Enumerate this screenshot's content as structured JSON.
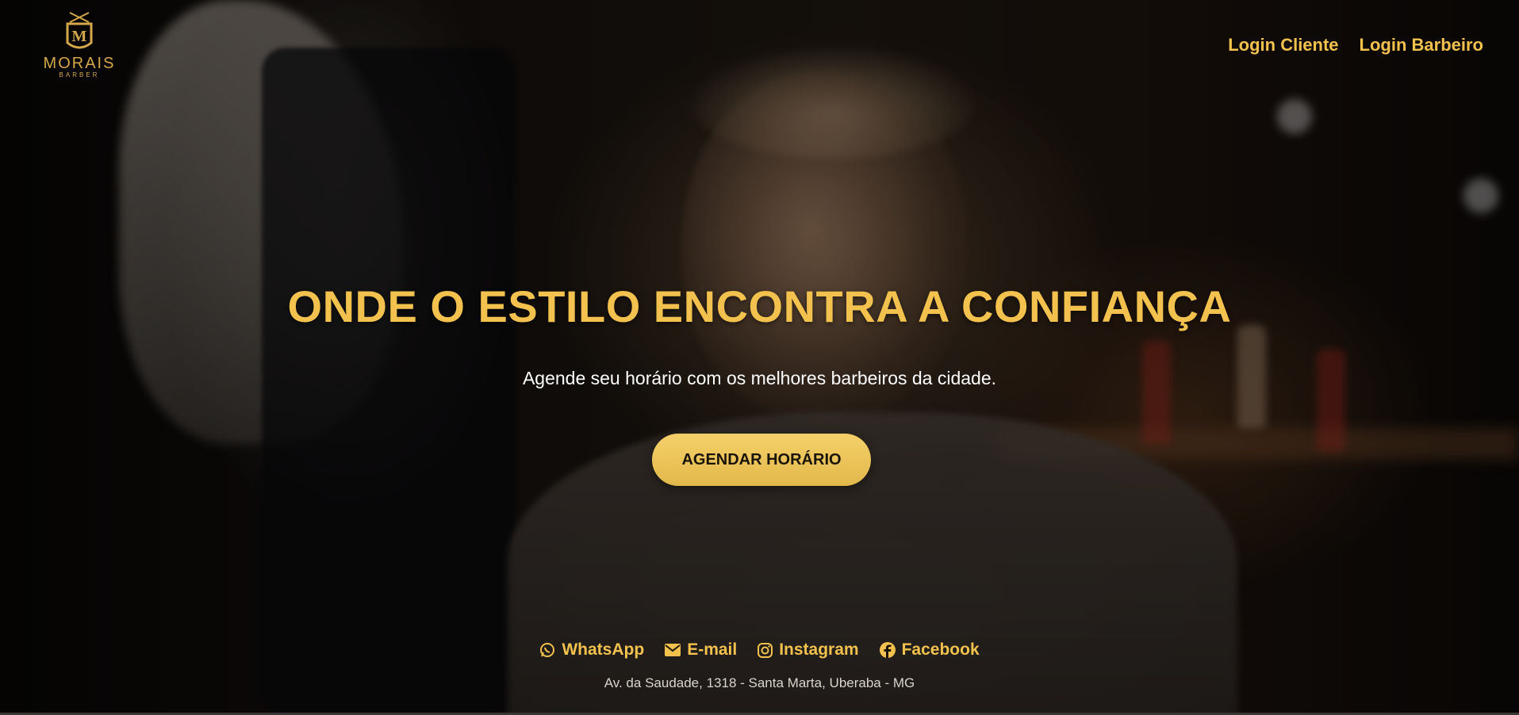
{
  "brand": {
    "name": "MORAIS",
    "sub": "BARBER",
    "logo_icon": "barber-crest-icon",
    "accent_color": "#f2c14e"
  },
  "nav": {
    "login_client": "Login Cliente",
    "login_barber": "Login Barbeiro"
  },
  "hero": {
    "headline": "ONDE O ESTILO ENCONTRA A CONFIANÇA",
    "subtitle": "Agende seu horário com os melhores barbeiros da cidade.",
    "cta_label": "AGENDAR HORÁRIO",
    "background_image": "barber-cutting-hair-photo"
  },
  "contacts": [
    {
      "label": "WhatsApp",
      "icon": "whatsapp-icon"
    },
    {
      "label": "E-mail",
      "icon": "envelope-icon"
    },
    {
      "label": "Instagram",
      "icon": "instagram-icon"
    },
    {
      "label": "Facebook",
      "icon": "facebook-icon"
    }
  ],
  "address": "Av. da Saudade, 1318 - Santa Marta, Uberaba - MG"
}
